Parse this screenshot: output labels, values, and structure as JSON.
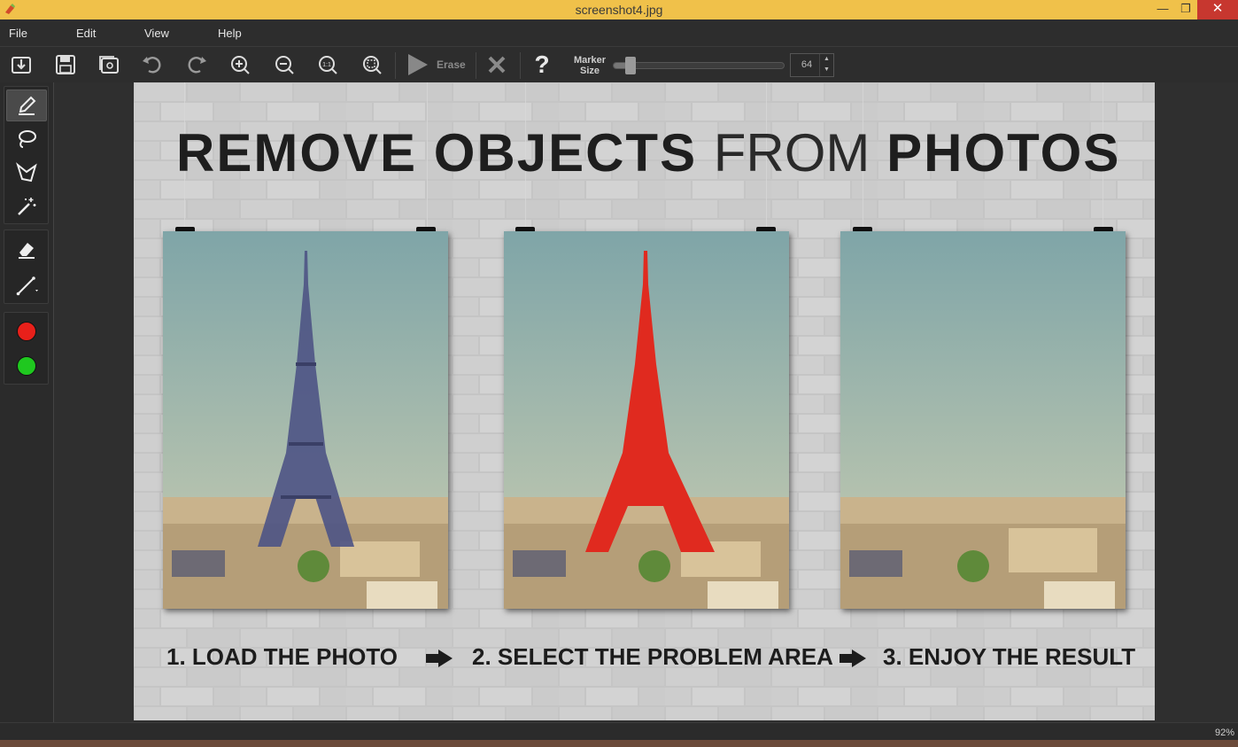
{
  "window": {
    "title": "screenshot4.jpg"
  },
  "menu": {
    "items": [
      "File",
      "Edit",
      "View",
      "Help"
    ]
  },
  "toolbar": {
    "erase_label": "Erase",
    "help_label": "?",
    "marker_size_label_1": "Marker",
    "marker_size_label_2": "Size",
    "marker_size_value": "64",
    "marker_size_fraction": 0.08
  },
  "tools": {
    "colors": {
      "red": "#e8201a",
      "green": "#1fc81f"
    }
  },
  "canvas": {
    "headline_bold_1": "REMOVE OBJECTS",
    "headline_thin": "FROM",
    "headline_bold_2": "PHOTOS",
    "step1": "1. LOAD THE PHOTO",
    "step2": "2. SELECT THE PROBLEM AREA",
    "step3": "3. ENJOY THE RESULT"
  },
  "status": {
    "zoom": "92%"
  },
  "colors": {
    "titlebar": "#f0c14a",
    "close": "#c7372f",
    "highlight": "#e02a1f"
  }
}
